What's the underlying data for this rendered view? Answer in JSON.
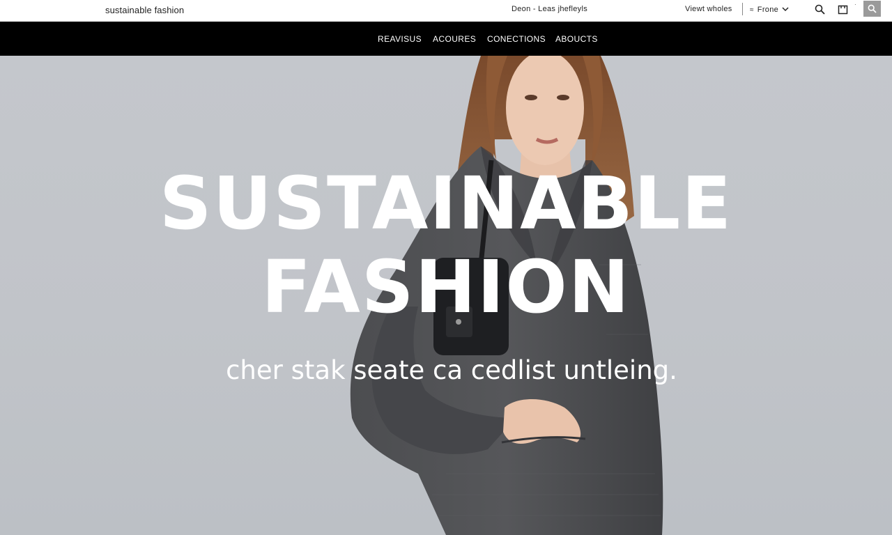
{
  "topbar": {
    "brand": "sustainable fashion",
    "promo": "Deon - Leas jhefleyls",
    "wishlist": "Viewt wholes",
    "region_glyph": "≈",
    "region": "Frone",
    "region_chevron": "⌵",
    "dot": "·"
  },
  "nav": {
    "items": [
      "REAVISUS",
      "ACOURES",
      "CONECTIONS",
      "ABOUCTS"
    ]
  },
  "hero": {
    "headline_line1": "SUSTAINABLE",
    "headline_line2": "FASHION",
    "tagline": "cher stak seate ca cedlist untleing."
  },
  "icons": {
    "search": "search-icon",
    "bag": "shopping-bag-icon",
    "chevron": "chevron-down-icon",
    "region": "region-icon"
  },
  "colors": {
    "nav_bg": "#000000",
    "hero_bg": "#c3c6cb",
    "coat": "#4a4b4e",
    "hair": "#8b5634",
    "search_box": "#9a9a9a"
  }
}
